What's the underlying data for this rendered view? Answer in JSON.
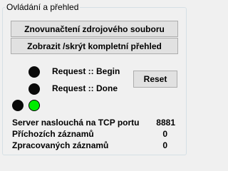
{
  "groupbox": {
    "title": "Ovládání a přehled"
  },
  "buttons": {
    "reload_label": "Znovunačtení zdrojového souboru",
    "toggle_label": "Zobrazit /skrýt kompletní přehled",
    "reset_label": "Reset"
  },
  "indicators": {
    "request_begin_label": "Request :: Begin",
    "request_done_label": "Request :: Done",
    "colors": {
      "off": "#0a0a0a",
      "on": "#00ee00"
    },
    "states": {
      "request_begin": "off",
      "request_done": "off",
      "status_left": "off",
      "status_right": "on"
    }
  },
  "stats": {
    "server_label": "Server naslouchá na TCP portu",
    "server_port": "8881",
    "incoming_label": "Příchozích záznamů",
    "incoming_value": "0",
    "processed_label": "Zpracovaných záznamů",
    "processed_value": "0"
  }
}
